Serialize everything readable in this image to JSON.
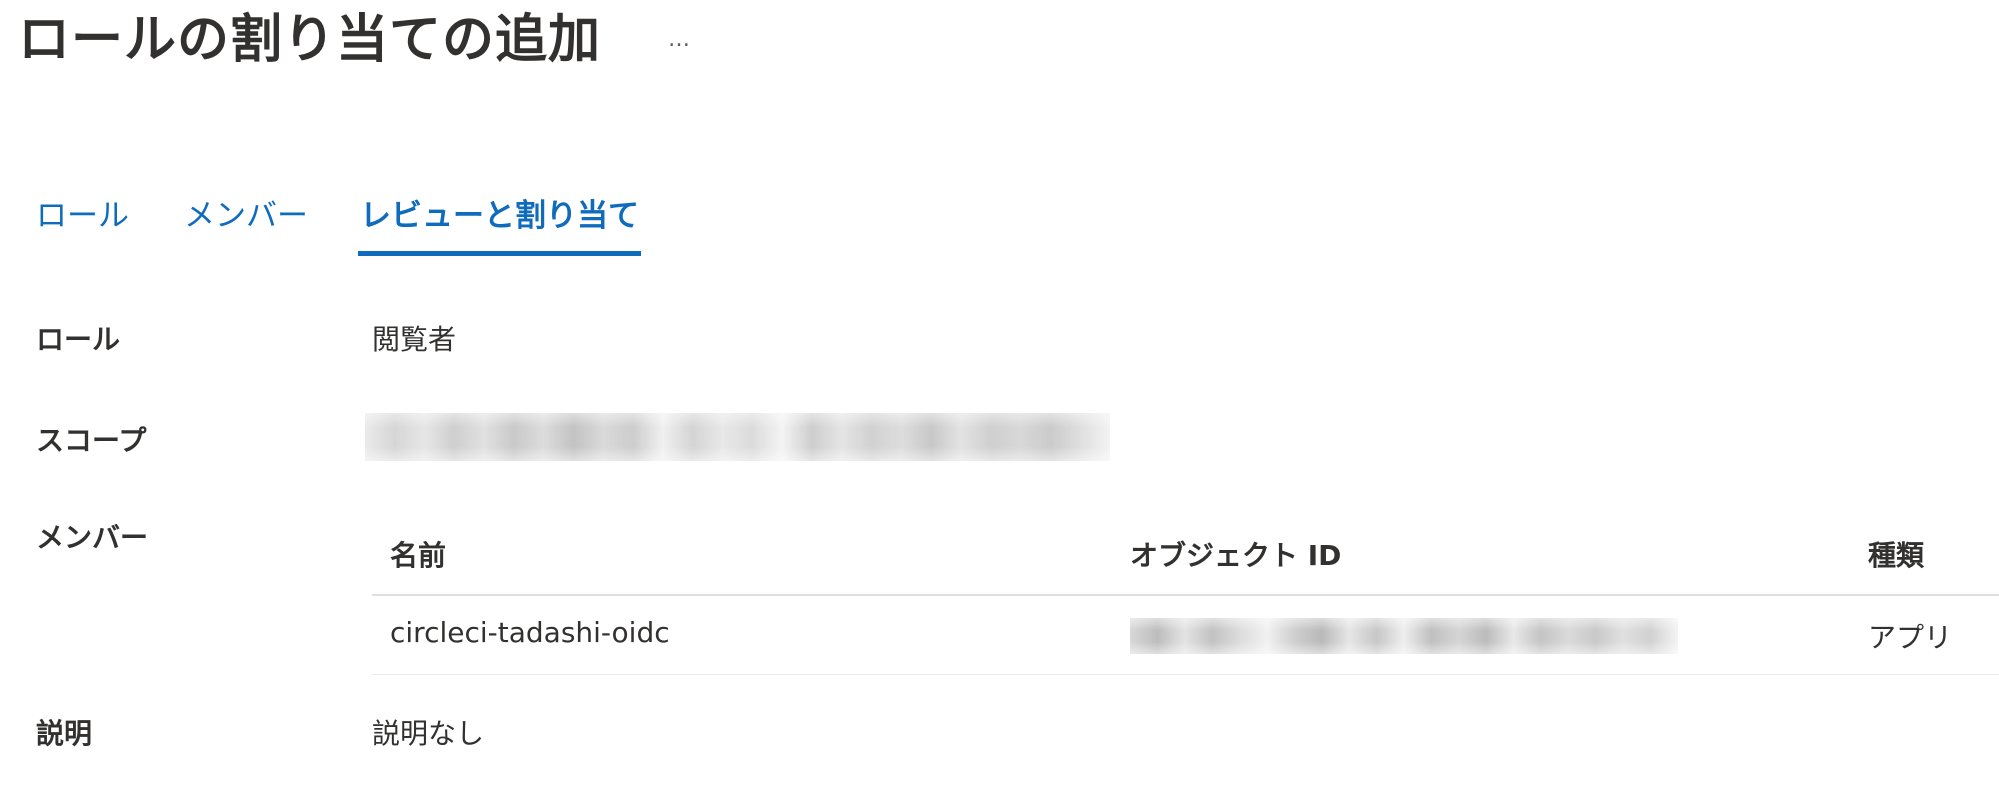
{
  "header": {
    "title": "ロールの割り当ての追加",
    "more_label": "…"
  },
  "tabs": [
    {
      "label": "ロール",
      "active": false
    },
    {
      "label": "メンバー",
      "active": false
    },
    {
      "label": "レビューと割り当て",
      "active": true
    }
  ],
  "review": {
    "role": {
      "label": "ロール",
      "value": "閲覧者"
    },
    "scope": {
      "label": "スコープ",
      "value_redacted": true
    },
    "members": {
      "label": "メンバー",
      "columns": [
        "名前",
        "オブジェクト ID",
        "種類"
      ],
      "rows": [
        {
          "name": "circleci-tadashi-oidc",
          "object_id_redacted": true,
          "type": "アプリ"
        }
      ]
    },
    "description": {
      "label": "説明",
      "value": "説明なし"
    }
  },
  "colors": {
    "accent": "#0f6cbd",
    "text": "#323130",
    "divider": "#e1dfdd"
  }
}
